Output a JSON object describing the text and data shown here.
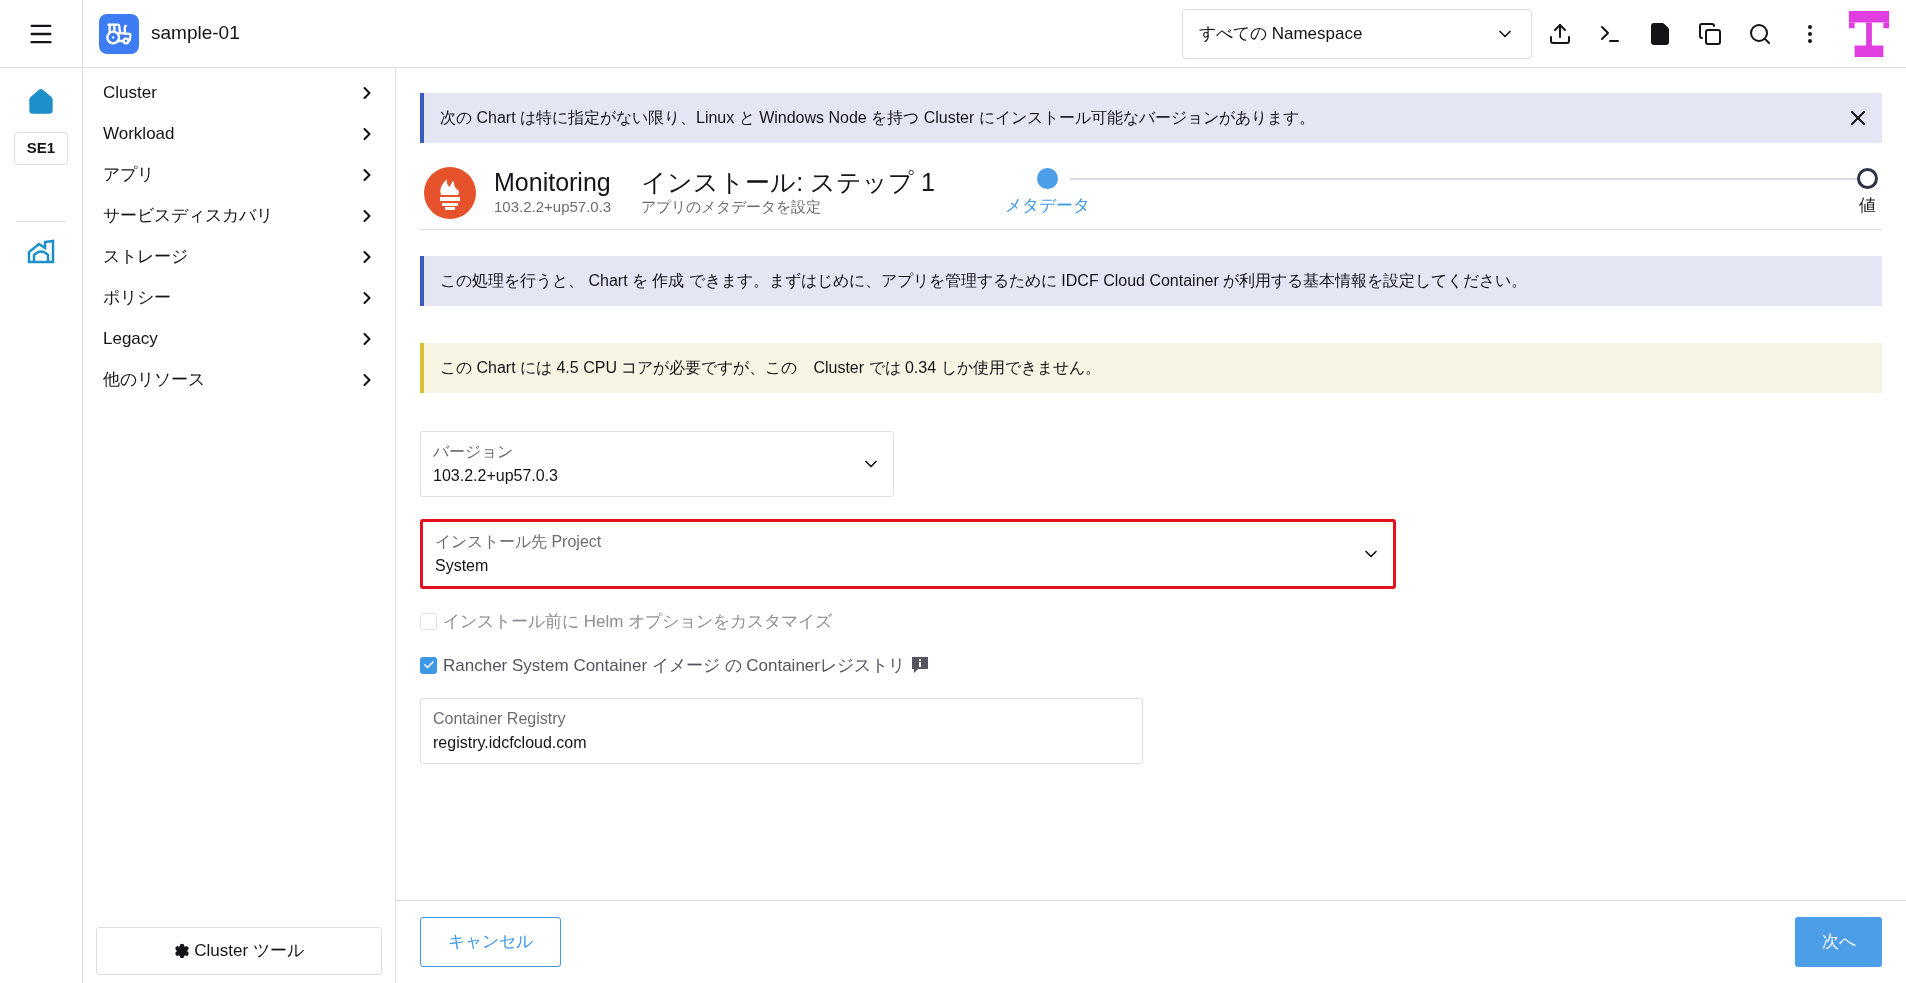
{
  "header": {
    "cluster_name": "sample-01",
    "namespace_select": {
      "value": "すべての Namespace"
    }
  },
  "rail": {
    "cluster_badge": "SE1"
  },
  "sidebar": {
    "items": [
      {
        "label": "Cluster"
      },
      {
        "label": "Workload"
      },
      {
        "label": "アプリ"
      },
      {
        "label": "サービスディスカバリ"
      },
      {
        "label": "ストレージ"
      },
      {
        "label": "ポリシー"
      },
      {
        "label": "Legacy"
      },
      {
        "label": "他のリソース"
      }
    ],
    "footer_button": "Cluster ツール"
  },
  "banner": {
    "text": "次の Chart は特に指定がない限り、Linux と Windows Node を持つ Cluster にインストール可能なバージョンがあります。"
  },
  "chart": {
    "name": "Monitoring",
    "version": "103.2.2+up57.0.3",
    "step_title": "インストール: ステップ 1",
    "step_subtitle": "アプリのメタデータを設定"
  },
  "stepper": [
    {
      "label": "メタデータ",
      "selected": true
    },
    {
      "label": "値",
      "selected": false
    }
  ],
  "info": {
    "text": "この処理を行うと、 Chart を 作成 できます。まずはじめに、アプリを管理するために IDCF Cloud Container が利用する基本情報を設定してください。"
  },
  "warning": {
    "text": "この Chart には 4.5 CPU コアが必要ですが、この　Cluster では 0.34 しか使用できません。"
  },
  "fields": [
    {
      "label": "バージョン",
      "value": "103.2.2+up57.0.3",
      "highlighted": false,
      "wide": false
    },
    {
      "label": "インストール先 Project",
      "value": "System",
      "highlighted": true,
      "wide": true
    }
  ],
  "checkboxes": [
    {
      "label": "インストール前に Helm オプションをカスタマイズ",
      "checked": false,
      "disabled": true,
      "info": false
    },
    {
      "label": "Rancher System Container イメージ の Containerレジストリ",
      "checked": true,
      "disabled": false,
      "info": true
    }
  ],
  "registry": {
    "label": "Container Registry",
    "value": "registry.idcfcloud.com"
  },
  "footer": {
    "cancel": "キャンセル",
    "next": "次へ"
  }
}
